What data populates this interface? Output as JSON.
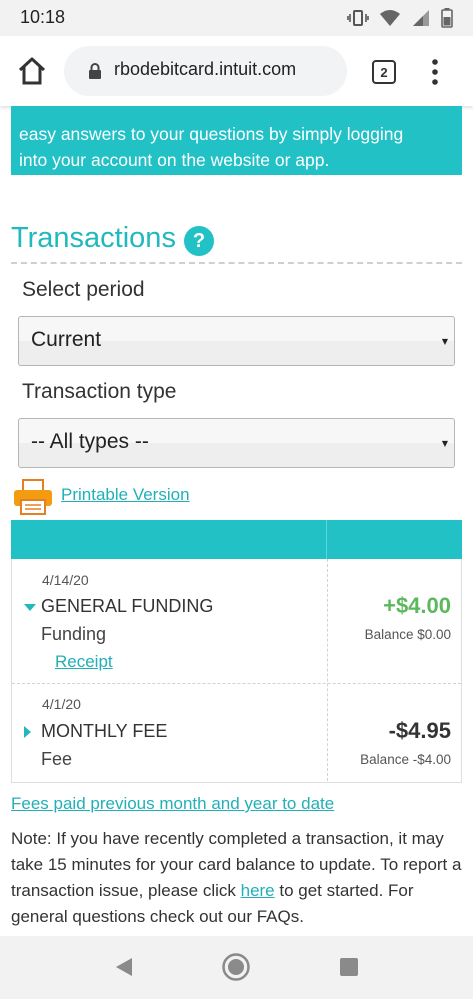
{
  "status_bar": {
    "time": "10:18"
  },
  "browser": {
    "url": "rbodebitcard.intuit.com",
    "tab_count": "2"
  },
  "banner": {
    "line1": "easy answers to your questions by simply logging",
    "line2": "into your account on the website or app."
  },
  "transactions": {
    "heading": "Transactions",
    "help_icon_glyph": "?",
    "period_label": "Select period",
    "period_value": "Current",
    "type_label": "Transaction type",
    "type_value": "-- All types --",
    "printable_label": "Printable Version"
  },
  "rows": [
    {
      "date": "4/14/20",
      "name": "GENERAL FUNDING",
      "category": "Funding",
      "receipt_label": "Receipt",
      "amount": "+$4.00",
      "amount_color": "#5cb85c",
      "balance": "Balance $0.00",
      "expanded": true
    },
    {
      "date": "4/1/20",
      "name": "MONTHLY FEE",
      "category": "Fee",
      "amount": "-$4.95",
      "amount_color": "#333333",
      "balance": "Balance -$4.00",
      "expanded": false
    }
  ],
  "footer": {
    "fees_link": "Fees paid previous month and year to date",
    "note_part1": "Note: If you have recently completed a transaction, it may take 15 minutes for your card balance to update. To report a transaction issue, please click ",
    "note_link": "here",
    "note_part2": " to get started. For general questions check out our FAQs."
  },
  "colors": {
    "accent": "#21c1c6",
    "link": "#21b0b8",
    "positive": "#5cb85c"
  }
}
